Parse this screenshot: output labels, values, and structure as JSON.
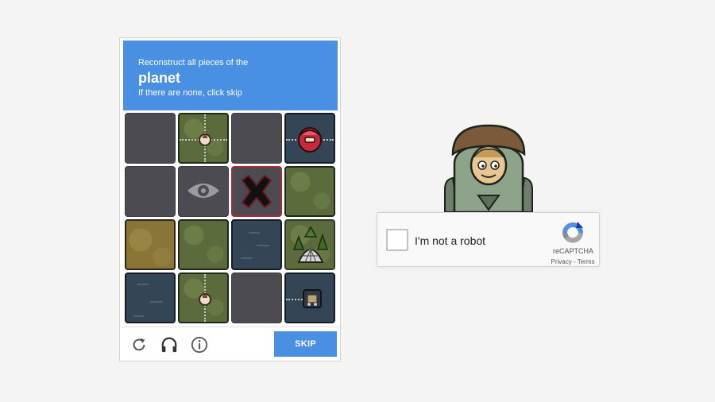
{
  "challenge": {
    "instruction": "Reconstruct all pieces of the",
    "target": "planet",
    "hint": "If there are none, click skip",
    "skip_label": "SKIP",
    "footer_icons": [
      "reload-icon",
      "headphones-icon",
      "info-icon"
    ],
    "grid": [
      [
        "empty",
        "grass-path",
        "empty",
        "water-portal"
      ],
      [
        "empty",
        "eye",
        "x-mark",
        "grass"
      ],
      [
        "sand",
        "grass",
        "water",
        "dome-trees"
      ],
      [
        "water",
        "grass-path",
        "empty",
        "water-cart"
      ]
    ]
  },
  "recaptcha": {
    "label": "I'm not a robot",
    "brand": "reCAPTCHA",
    "privacy": "Privacy",
    "separator": " - ",
    "terms": "Terms",
    "checked": false
  },
  "colors": {
    "accent": "#4a90e2",
    "tile_border_red": "#b02836",
    "background": "#f4f4f4"
  }
}
